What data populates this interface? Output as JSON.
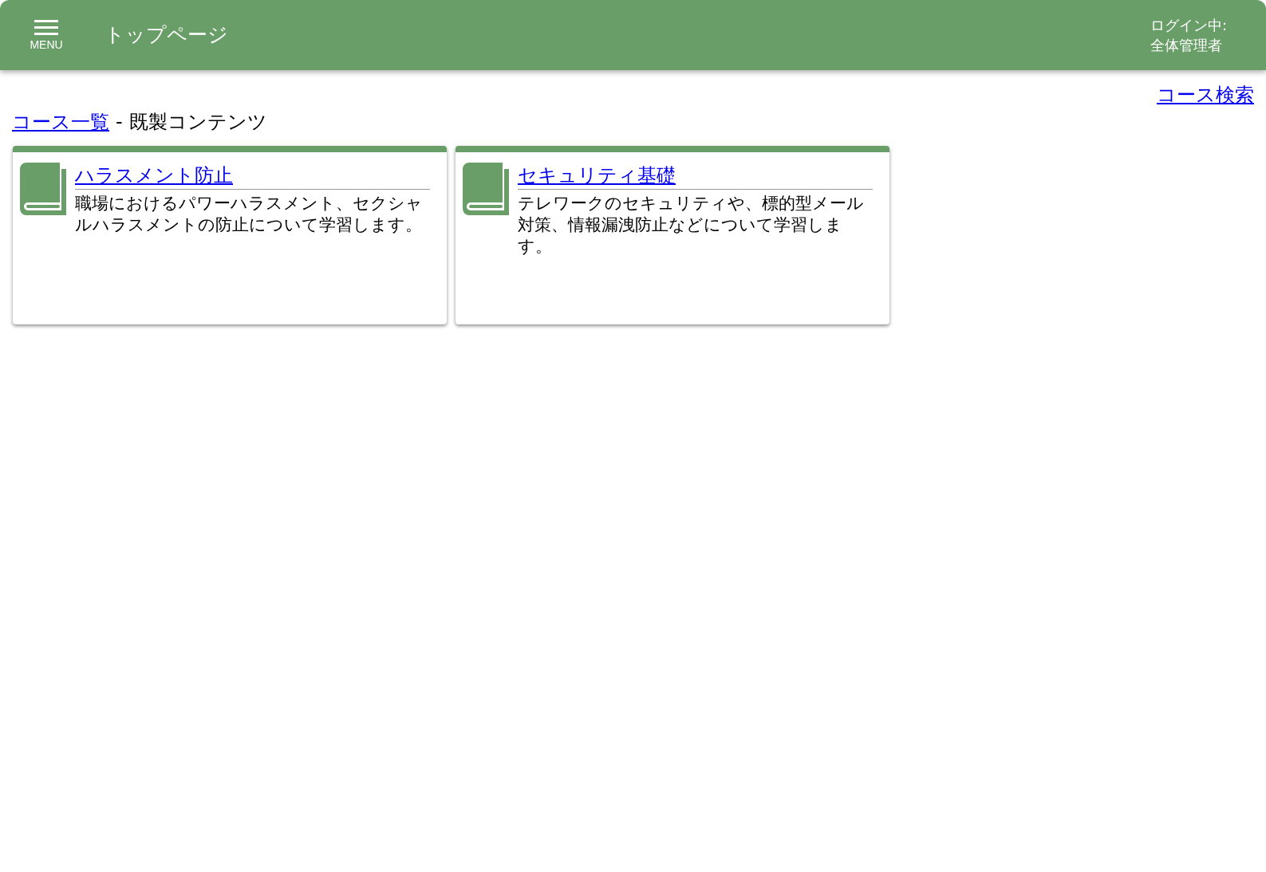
{
  "header": {
    "menu_label": "MENU",
    "title": "トップページ",
    "login_label": "ログイン中:",
    "login_user": "全体管理者"
  },
  "search_link": "コース検索",
  "breadcrumb": {
    "link": "コース一覧",
    "separator": "-",
    "current": "既製コンテンツ"
  },
  "courses": [
    {
      "title": "ハラスメント防止",
      "description": "職場におけるパワーハラスメント、セクシャルハラスメントの防止について学習します。"
    },
    {
      "title": "セキュリティ基礎",
      "description": "テレワークのセキュリティや、標的型メール対策、情報漏洩防止などについて学習します。"
    }
  ]
}
